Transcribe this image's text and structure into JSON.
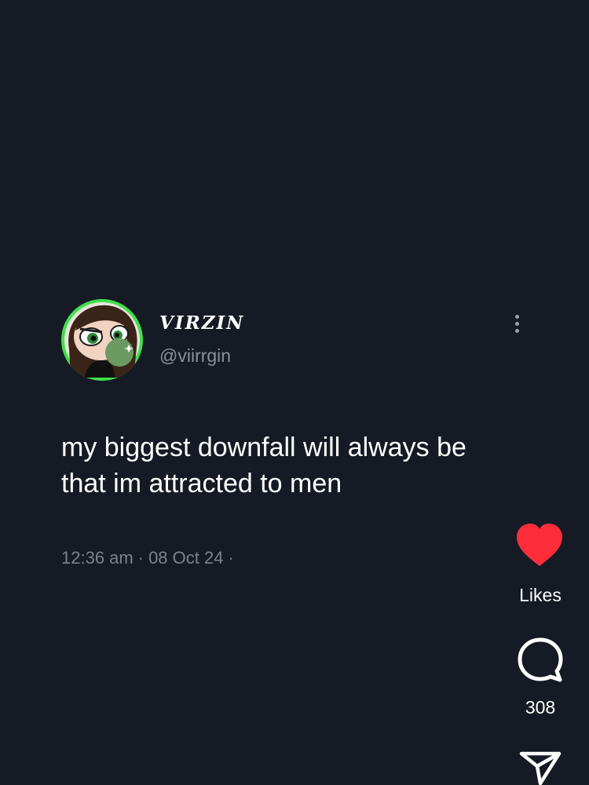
{
  "user": {
    "display_name": "VIRZIN",
    "handle": "@viirrgin"
  },
  "post": {
    "text": "my biggest downfall will always be that im attracted to men",
    "time": "12:36 am",
    "date": "08 Oct 24",
    "separator": "·"
  },
  "actions": {
    "likes_label": "Likes",
    "comment_count": "308"
  },
  "icons": {
    "avatar": "cartoon-girl-avatar",
    "more": "more-vertical-icon",
    "like": "heart-icon",
    "comment": "comment-bubble-icon",
    "share": "paper-plane-icon"
  },
  "colors": {
    "background": "#151a24",
    "like": "#ff2d3a",
    "avatar_ring": "#3fe04a",
    "secondary_text": "#8b919b"
  }
}
